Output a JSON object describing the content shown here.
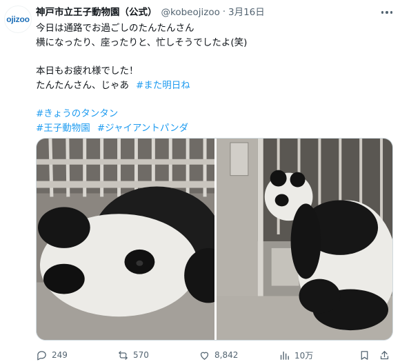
{
  "tweet": {
    "avatar_text": "ojizoo",
    "display_name": "神戸市立王子動物園（公式）",
    "handle": "@kobeojizoo",
    "separator": "·",
    "date": "3月16日",
    "lines": [
      "今日は通路でお過ごしのたんたんさん",
      "横になったり、座ったりと、忙しそうでしたよ(笑)"
    ],
    "line3": "本日もお疲れ様でした！",
    "line4_text": "たんたんさん、じゃあ",
    "line4_hashtag": "#また明日ね",
    "hashtag_line1": "#きょうのタンタン",
    "hashtag_line2a": "#王子動物園",
    "hashtag_line2b": "#ジャイアントパンダ",
    "images": [
      {
        "name": "panda-lying-photo",
        "alt": "Giant panda lying down in enclosure"
      },
      {
        "name": "panda-sitting-photo",
        "alt": "Giant panda sitting by door"
      }
    ]
  },
  "actions": {
    "replies": "249",
    "reposts": "570",
    "likes": "8,842",
    "views": "10万"
  },
  "colors": {
    "text": "#0f1419",
    "secondary": "#536471",
    "link": "#1d9bf0",
    "border": "#cfd9de"
  }
}
